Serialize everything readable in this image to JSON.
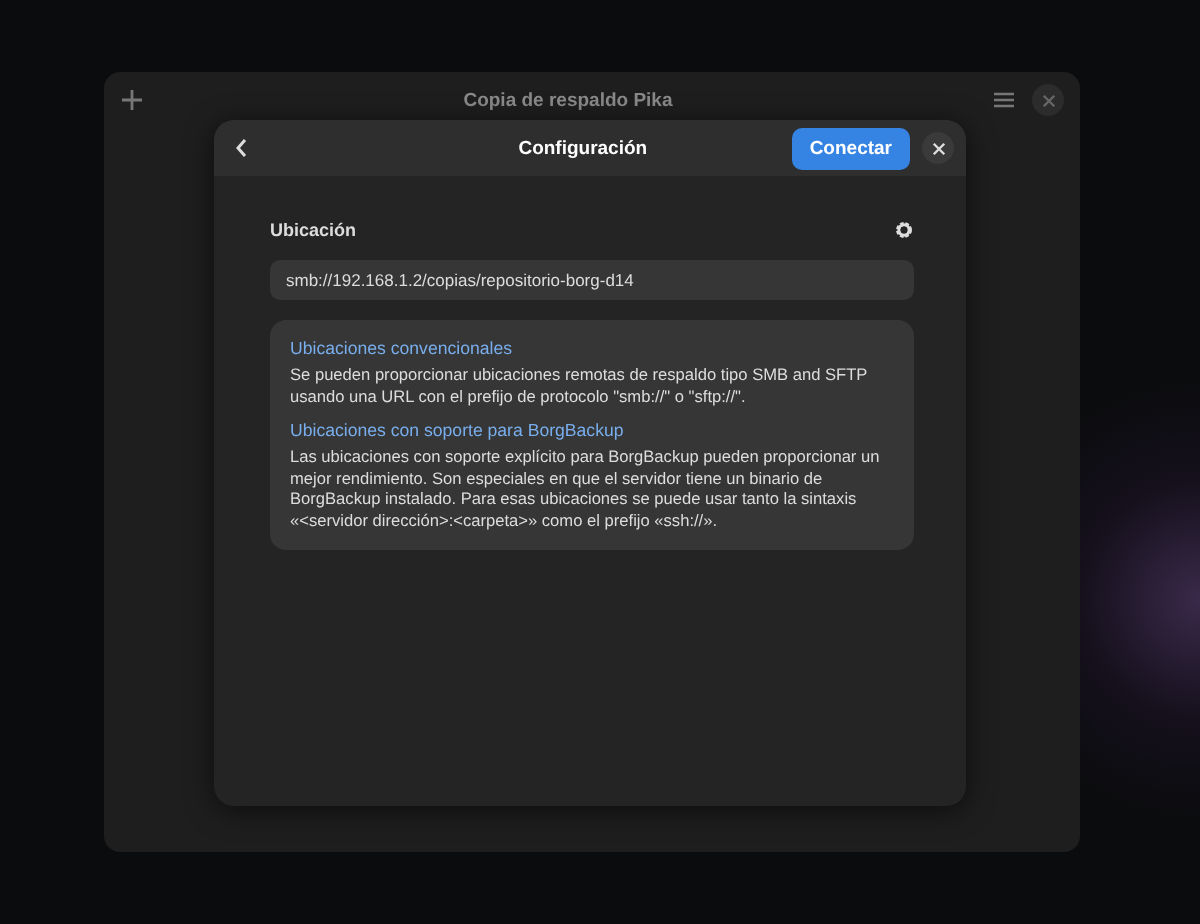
{
  "window": {
    "title": "Copia de respaldo Pika"
  },
  "dialog": {
    "title": "Configuración",
    "primary_button": "Conectar"
  },
  "location": {
    "label": "Ubicación",
    "value": "smb://192.168.1.2/copias/repositorio-borg-d14"
  },
  "info": [
    {
      "heading": "Ubicaciones convencionales",
      "text": "Se pueden proporcionar ubicaciones remotas de respaldo tipo SMB and SFTP usando una URL con el prefijo de protocolo \"smb://\" o \"sftp://\"."
    },
    {
      "heading": "Ubicaciones con soporte para BorgBackup",
      "text": "Las ubicaciones con soporte explícito para BorgBackup pueden proporcionar un mejor rendimiento. Son especiales en que el servidor tiene un binario de BorgBackup instalado. Para esas ubicaciones se puede usar tanto la sintaxis «<servidor dirección>:<carpeta>» como el prefijo «ssh://»."
    }
  ]
}
